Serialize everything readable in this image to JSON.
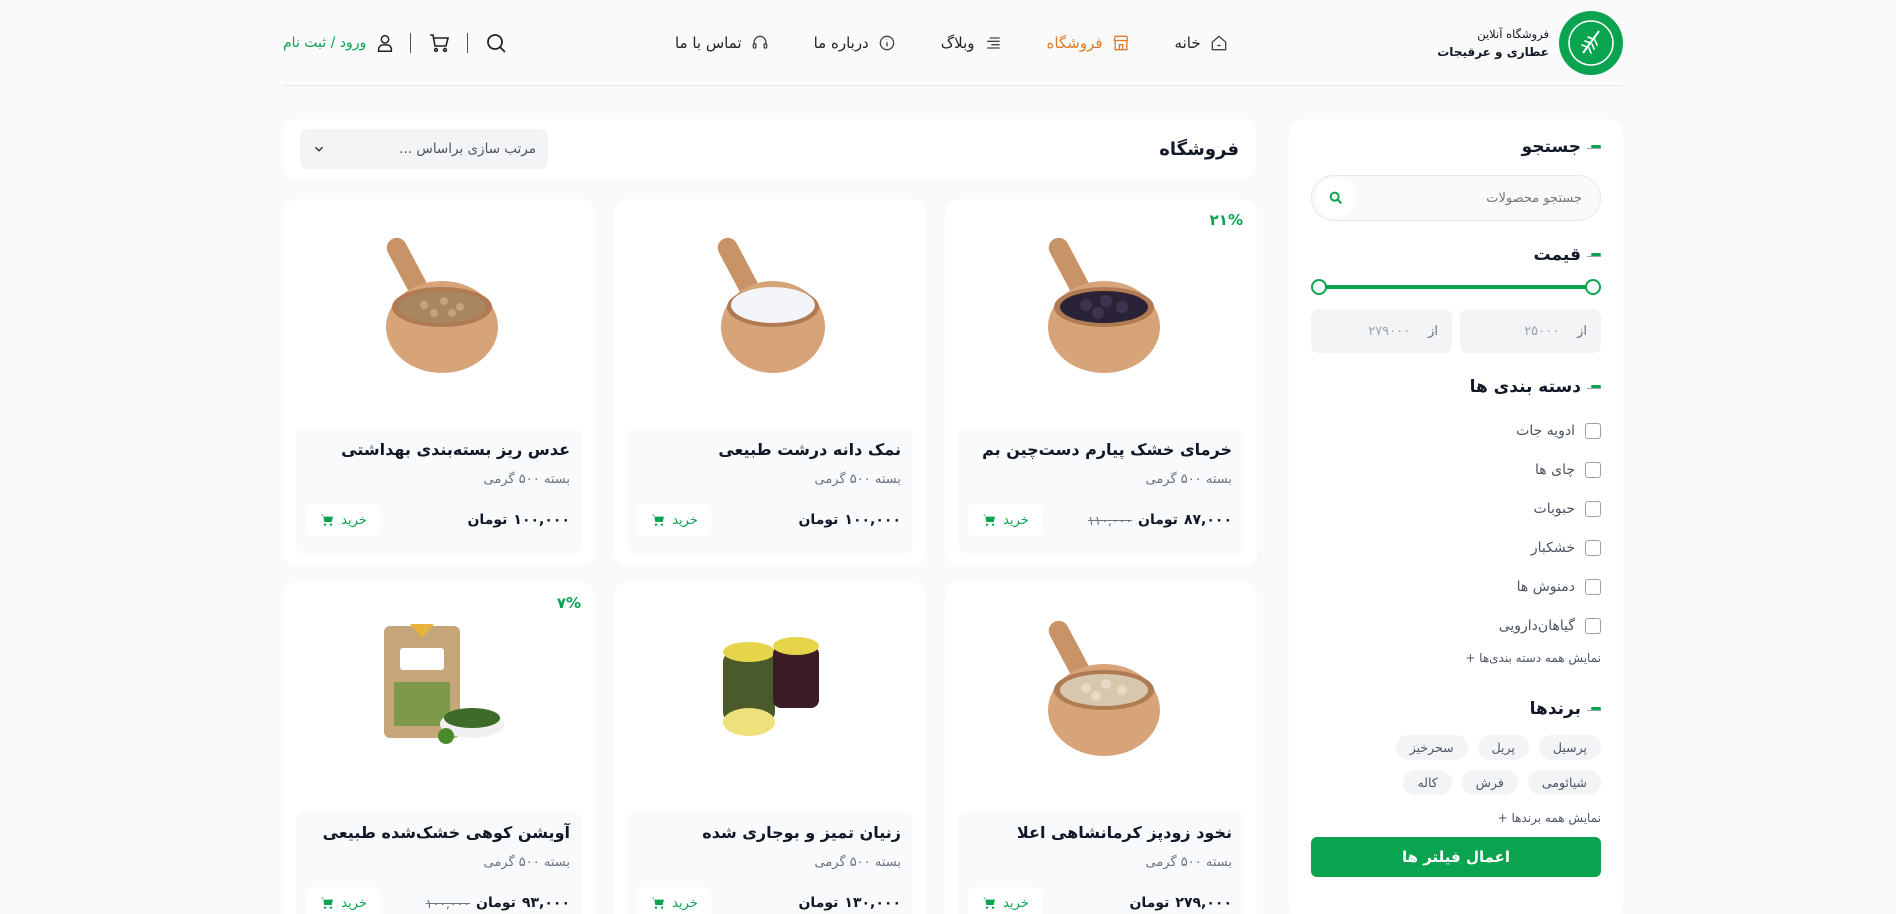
{
  "header": {
    "brand_line1": "فروشگاه آنلاین",
    "brand_line2": "عطاری و عرقیجات",
    "nav": [
      {
        "label": "خانه",
        "icon": "home-icon"
      },
      {
        "label": "فروشگاه",
        "icon": "store-icon",
        "active": true
      },
      {
        "label": "وبلاگ",
        "icon": "list-icon"
      },
      {
        "label": "درباره ما",
        "icon": "info-icon"
      },
      {
        "label": "تماس با ما",
        "icon": "headset-icon"
      }
    ],
    "login_label": "ورود / ثبت نام",
    "accent_color": "#0aa34f",
    "active_color": "#e07a26"
  },
  "sidebar": {
    "search_title": "جستجو",
    "search_placeholder": "جستجو محصولات",
    "price_title": "قیمت",
    "price_from_label": "از",
    "price_min": "۲۵۰۰۰",
    "price_to_label": "از",
    "price_max": "۲۷۹۰۰۰",
    "categories_title": "دسته بندی ها",
    "categories": [
      "ادویه جات",
      "چای ها",
      "حبوبات",
      "خشکبار",
      "دمنوش ها",
      "گیاهان‌دارویی"
    ],
    "show_all_categories": "نمایش همه دسته بندی‌ها +",
    "brands_title": "برندها",
    "brands": [
      "پرسیل",
      "پریل",
      "سحرخیز",
      "شیائومی",
      "فرش",
      "کاله"
    ],
    "show_all_brands": "نمایش همه برندها +",
    "apply_label": "اعمال فیلتر ها"
  },
  "toolbar": {
    "title": "فروشگاه",
    "sort_label": "مرتب سازی براساس ..."
  },
  "products": [
    {
      "name": "خرمای خشک پیارم دست‌چین بم",
      "sub": "بسته ۵۰۰ گرمی",
      "price": "۸۷,۰۰۰",
      "currency": "تومان",
      "old": "۱۱۰,۰۰۰",
      "discount": "۲۱%",
      "buy": "خرید",
      "img": "dark-berries"
    },
    {
      "name": "نمک دانه درشت طبیعی",
      "sub": "بسته ۵۰۰ گرمی",
      "price": "۱۰۰,۰۰۰",
      "currency": "تومان",
      "old": "",
      "discount": "",
      "buy": "خرید",
      "img": "white-salt"
    },
    {
      "name": "عدس ریز بسته‌بندی بهداشتی",
      "sub": "بسته ۵۰۰ گرمی",
      "price": "۱۰۰,۰۰۰",
      "currency": "تومان",
      "old": "",
      "discount": "",
      "buy": "خرید",
      "img": "brown-seeds"
    },
    {
      "name": "نخود زودپز کرمانشاهی اعلا",
      "sub": "بسته ۵۰۰ گرمی",
      "price": "۲۷۹,۰۰۰",
      "currency": "تومان",
      "old": "",
      "discount": "",
      "buy": "خرید",
      "img": "beige-seeds"
    },
    {
      "name": "زنیان تمیز و بوجاری شده",
      "sub": "بسته ۵۰۰ گرمی",
      "price": "۱۳۰,۰۰۰",
      "currency": "تومان",
      "old": "",
      "discount": "",
      "buy": "خرید",
      "img": "jars"
    },
    {
      "name": "آویشن کوهی خشک‌شده طبیعی",
      "sub": "بسته ۵۰۰ گرمی",
      "price": "۹۳,۰۰۰",
      "currency": "تومان",
      "old": "۱۰۰,۰۰۰",
      "discount": "۷%",
      "buy": "خرید",
      "img": "herb-bag"
    }
  ]
}
